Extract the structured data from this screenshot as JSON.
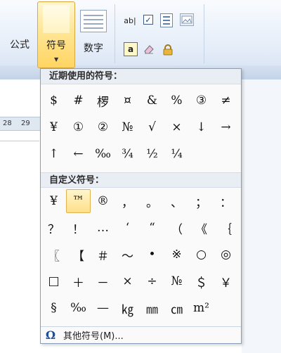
{
  "ribbon": {
    "formula_label": "公式",
    "symbol_label": "符号",
    "number_label": "数字",
    "abl_text": "ab|",
    "check_mark": "✓",
    "text_box_letter": "a"
  },
  "ruler": {
    "left_number": "28",
    "right_number": "29"
  },
  "symbol_panel": {
    "recent_title": "近期使用的符号：",
    "recent_symbols": [
      "$",
      "#",
      "椤",
      "¤",
      "&",
      "%",
      "③",
      "≠",
      "¥",
      "①",
      "②",
      "№",
      "√",
      "×",
      "↓",
      "→",
      "↑",
      "←",
      "‰",
      "¾",
      "½",
      "¼"
    ],
    "custom_title": "自定义符号：",
    "custom_symbols": [
      "¥",
      "™",
      "®",
      "，",
      "。",
      "、",
      "；",
      "：",
      "？",
      "！",
      "…",
      "‘",
      "“",
      "（",
      "《",
      "｛",
      "〖",
      "【",
      "＃",
      "～",
      "•",
      "※",
      "○",
      "◎",
      "□",
      "＋",
      "－",
      "×",
      "÷",
      "№",
      "＄",
      "￥",
      "§",
      "‰",
      "—",
      "㎏",
      "㎜",
      "㎝",
      "m²"
    ],
    "selected_custom_index": 1,
    "more_symbols_label": "其他符号(M)..."
  },
  "colors": {
    "selected_bg": "#ffe08a",
    "header_bg": "#e9eef5",
    "panel_border": "#8b9db7"
  }
}
